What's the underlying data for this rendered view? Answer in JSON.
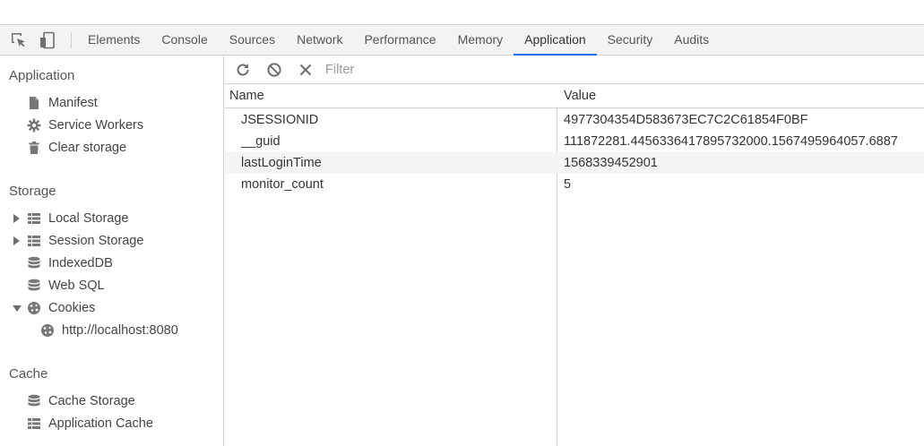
{
  "tabs": [
    {
      "label": "Elements"
    },
    {
      "label": "Console"
    },
    {
      "label": "Sources"
    },
    {
      "label": "Network"
    },
    {
      "label": "Performance"
    },
    {
      "label": "Memory"
    },
    {
      "label": "Application",
      "active": true
    },
    {
      "label": "Security"
    },
    {
      "label": "Audits"
    }
  ],
  "sidebar": {
    "application": {
      "title": "Application",
      "items": [
        {
          "label": "Manifest",
          "icon": "document-icon"
        },
        {
          "label": "Service Workers",
          "icon": "gear-icon"
        },
        {
          "label": "Clear storage",
          "icon": "trash-icon"
        }
      ]
    },
    "storage": {
      "title": "Storage",
      "items": [
        {
          "label": "Local Storage",
          "icon": "grid-icon",
          "expandable": "collapsed"
        },
        {
          "label": "Session Storage",
          "icon": "grid-icon",
          "expandable": "collapsed"
        },
        {
          "label": "IndexedDB",
          "icon": "database-icon"
        },
        {
          "label": "Web SQL",
          "icon": "database-icon"
        },
        {
          "label": "Cookies",
          "icon": "cookie-icon",
          "expandable": "expanded"
        },
        {
          "label": "http://localhost:8080",
          "icon": "cookie-icon",
          "child": true,
          "selected": true
        }
      ]
    },
    "cache": {
      "title": "Cache",
      "items": [
        {
          "label": "Cache Storage",
          "icon": "database-icon"
        },
        {
          "label": "Application Cache",
          "icon": "grid-icon"
        }
      ]
    }
  },
  "toolbar": {
    "filter_placeholder": "Filter",
    "refresh_icon": "refresh-icon",
    "clear_all_icon": "block-icon",
    "delete_icon": "close-icon"
  },
  "grid": {
    "headers": {
      "name": "Name",
      "value": "Value"
    },
    "rows": [
      {
        "name": "JSESSIONID",
        "value": "4977304354D583673EC7C2C61854F0BF"
      },
      {
        "name": "__guid",
        "value": "111872281.4456336417895732000.1567495964057.6887"
      },
      {
        "name": "lastLoginTime",
        "value": "1568339452901"
      },
      {
        "name": "monitor_count",
        "value": "5"
      }
    ]
  },
  "colors": {
    "accent": "#1a73e8",
    "border": "#cfcfcf",
    "toolbar_bg": "#f3f3f3",
    "row_alt": "#f4f5f7"
  }
}
